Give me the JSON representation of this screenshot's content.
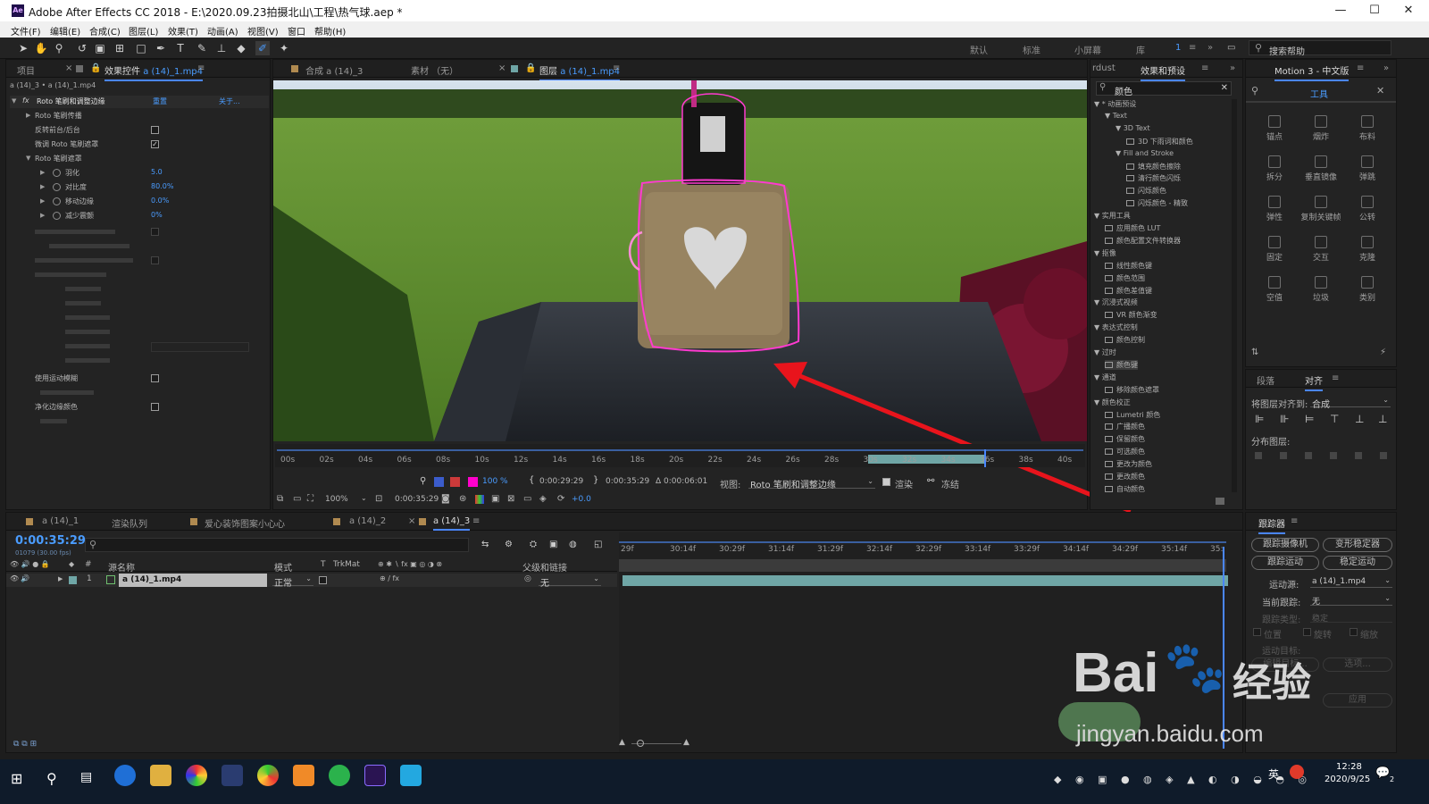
{
  "titlebar": {
    "logo": "Ae",
    "title": "Adobe After Effects CC 2018 - E:\\2020.09.23拍摄北山\\工程\\热气球.aep *",
    "min_icon": "minimize-icon",
    "max_icon": "maximize-icon",
    "close_icon": "close-icon"
  },
  "menu": [
    "文件(F)",
    "编辑(E)",
    "合成(C)",
    "图层(L)",
    "效果(T)",
    "动画(A)",
    "视图(V)",
    "窗口",
    "帮助(H)"
  ],
  "workspaces": [
    "默认",
    "标准",
    "小屏幕",
    "库"
  ],
  "ws_num": "1",
  "search_help": "搜索帮助",
  "left_tabs": {
    "project": "项目",
    "effects": "效果控件",
    "effects_file": "a (14)_1.mp4"
  },
  "fx_breadcrumb": "a (14)_3 • a (14)_1.mp4",
  "fx": {
    "fx_label": "fx",
    "name": "Roto 笔刷和调整边缘",
    "reset": "重置",
    "about": "关于...",
    "props": [
      {
        "label": "Roto 笔刷传播",
        "value": "",
        "type": "group",
        "dim": false
      },
      {
        "label": "反转前台/后台",
        "value": "",
        "type": "check",
        "checked": false,
        "dim": false
      },
      {
        "label": "微调 Roto 笔刷遮罩",
        "value": "",
        "type": "check",
        "checked": true,
        "dim": false
      },
      {
        "label": "Roto 笔刷遮罩",
        "value": "",
        "type": "group-open",
        "dim": false
      },
      {
        "label": "羽化",
        "value": "5.0",
        "type": "num",
        "dim": false
      },
      {
        "label": "对比度",
        "value": "80.0%",
        "type": "num",
        "dim": false
      },
      {
        "label": "移动边缘",
        "value": "0.0%",
        "type": "num",
        "dim": false
      },
      {
        "label": "减少震颤",
        "value": "0%",
        "type": "num",
        "dim": false
      },
      {
        "label": "使用运动模糊",
        "value": "",
        "type": "check",
        "checked": false,
        "dim": false
      },
      {
        "label": "净化边缘颜色",
        "value": "",
        "type": "check",
        "checked": false,
        "dim": false
      }
    ]
  },
  "viewer_tabs": {
    "comp": "合成 a (14)_3",
    "footage": "素材 （无）",
    "layer": "图层",
    "layer_file": "a (14)_1.mp4"
  },
  "ruler_ticks": [
    "00s",
    "02s",
    "04s",
    "06s",
    "08s",
    "10s",
    "12s",
    "14s",
    "16s",
    "18s",
    "20s",
    "22s",
    "24s",
    "26s",
    "28s",
    "30s",
    "32s",
    "34s",
    "36s",
    "38s",
    "40s"
  ],
  "viewer": {
    "zoom_pct": "100 %",
    "time_in": "0:00:29:29",
    "time_out": "0:00:35:29",
    "duration": "Δ 0:00:06:01",
    "view_label": "视图:",
    "view_value": "Roto 笔刷和调整边缘",
    "render_label": "渲染",
    "freeze_label": "冻结",
    "zoom": "100%",
    "current_time": "0:00:35:29",
    "offset": "+0.0"
  },
  "effects_panel": {
    "tab_left": "rdust",
    "tab": "效果和预设",
    "search": "颜色",
    "tree": [
      {
        "t": "▼ * 动画预设",
        "l": 0
      },
      {
        "t": "▼ Text",
        "l": 1
      },
      {
        "t": "▼ 3D Text",
        "l": 2
      },
      {
        "t": "3D 下雨词和颜色",
        "l": 3
      },
      {
        "t": "▼ Fill and Stroke",
        "l": 2
      },
      {
        "t": "填充颜色擦除",
        "l": 3
      },
      {
        "t": "清行颜色闪烁",
        "l": 3
      },
      {
        "t": "闪烁颜色",
        "l": 3
      },
      {
        "t": "闪烁颜色 - 精致",
        "l": 3
      },
      {
        "t": "▼ 实用工具",
        "l": 0
      },
      {
        "t": "应用颜色 LUT",
        "l": 1
      },
      {
        "t": "颜色配置文件转换器",
        "l": 1
      },
      {
        "t": "▼ 抠像",
        "l": 0
      },
      {
        "t": "线性颜色键",
        "l": 1
      },
      {
        "t": "颜色范围",
        "l": 1
      },
      {
        "t": "颜色差值键",
        "l": 1
      },
      {
        "t": "▼ 沉浸式视频",
        "l": 0
      },
      {
        "t": "VR 颜色渐变",
        "l": 1
      },
      {
        "t": "▼ 表达式控制",
        "l": 0
      },
      {
        "t": "颜色控制",
        "l": 1
      },
      {
        "t": "▼ 过时",
        "l": 0
      },
      {
        "t": "颜色键",
        "l": 1
      },
      {
        "t": "▼ 通道",
        "l": 0
      },
      {
        "t": "移除颜色遮罩",
        "l": 1
      },
      {
        "t": "▼ 颜色校正",
        "l": 0
      },
      {
        "t": "Lumetri 颜色",
        "l": 1
      },
      {
        "t": "广播颜色",
        "l": 1
      },
      {
        "t": "保留颜色",
        "l": 1
      },
      {
        "t": "可选颜色",
        "l": 1
      },
      {
        "t": "更改为颜色",
        "l": 1
      },
      {
        "t": "更改颜色",
        "l": 1
      },
      {
        "t": "自动颜色",
        "l": 1
      }
    ]
  },
  "motion": {
    "tab": "Motion 3 - 中文版",
    "tools_tab": "工具",
    "tools": [
      "锚点",
      "烟炸",
      "布料",
      "拆分",
      "垂直镜像",
      "弹跳",
      "弹性",
      "复制关键帧",
      "公转",
      "固定",
      "交互",
      "克隆",
      "空值",
      "垃圾",
      "类别"
    ]
  },
  "align": {
    "tab1": "段落",
    "tab2": "对齐",
    "align_to_label": "将图层对齐到:",
    "align_to_value": "合成",
    "distribute": "分布图层:"
  },
  "timeline_tabs": [
    "a (14)_1",
    "渲染队列",
    "爱心装饰图案小心心",
    "a (14)_2",
    "a (14)_3"
  ],
  "timeline": {
    "timecode": "0:00:35:29",
    "frame_info": "01079 (30.00 fps)",
    "cols": {
      "num": "#",
      "source": "源名称",
      "mode": "模式",
      "t": "T",
      "trkmat": "TrkMat",
      "parent": "父级和链接"
    },
    "layer": {
      "num": "1",
      "name": "a (14)_1.mp4",
      "mode": "正常",
      "parent": "无"
    },
    "ticks": [
      "29f",
      "30:14f",
      "30:29f",
      "31:14f",
      "31:29f",
      "32:14f",
      "32:29f",
      "33:14f",
      "33:29f",
      "34:14f",
      "34:29f",
      "35:14f",
      "35:"
    ]
  },
  "tracker": {
    "tab": "跟踪器",
    "btn_camera": "跟踪摄像机",
    "btn_warp": "变形稳定器",
    "btn_motion": "跟踪运动",
    "btn_stabilize": "稳定运动",
    "source_label": "运动源:",
    "source_value": "a (14)_1.mp4",
    "current_label": "当前跟踪:",
    "current_value": "无",
    "type_label": "跟踪类型:",
    "type_value": "稳定",
    "position": "位置",
    "rotation": "旋转",
    "scale": "缩放",
    "target": "运动目标:",
    "edit_target": "编辑目标...",
    "options": "选项...",
    "apply": "应用"
  },
  "watermark": {
    "text1": "Bai",
    "text2": "经验",
    "sub": "jingyan.baidu.com"
  },
  "taskbar": {
    "time": "12:28",
    "date": "2020/9/25",
    "ime": "英",
    "notif": "2"
  },
  "colors": {
    "accent": "#4a86ff",
    "mask": "#ff3ad0",
    "arrow": "#e8141c",
    "bg": "#232323",
    "trackbar": "#6fa6a6"
  }
}
